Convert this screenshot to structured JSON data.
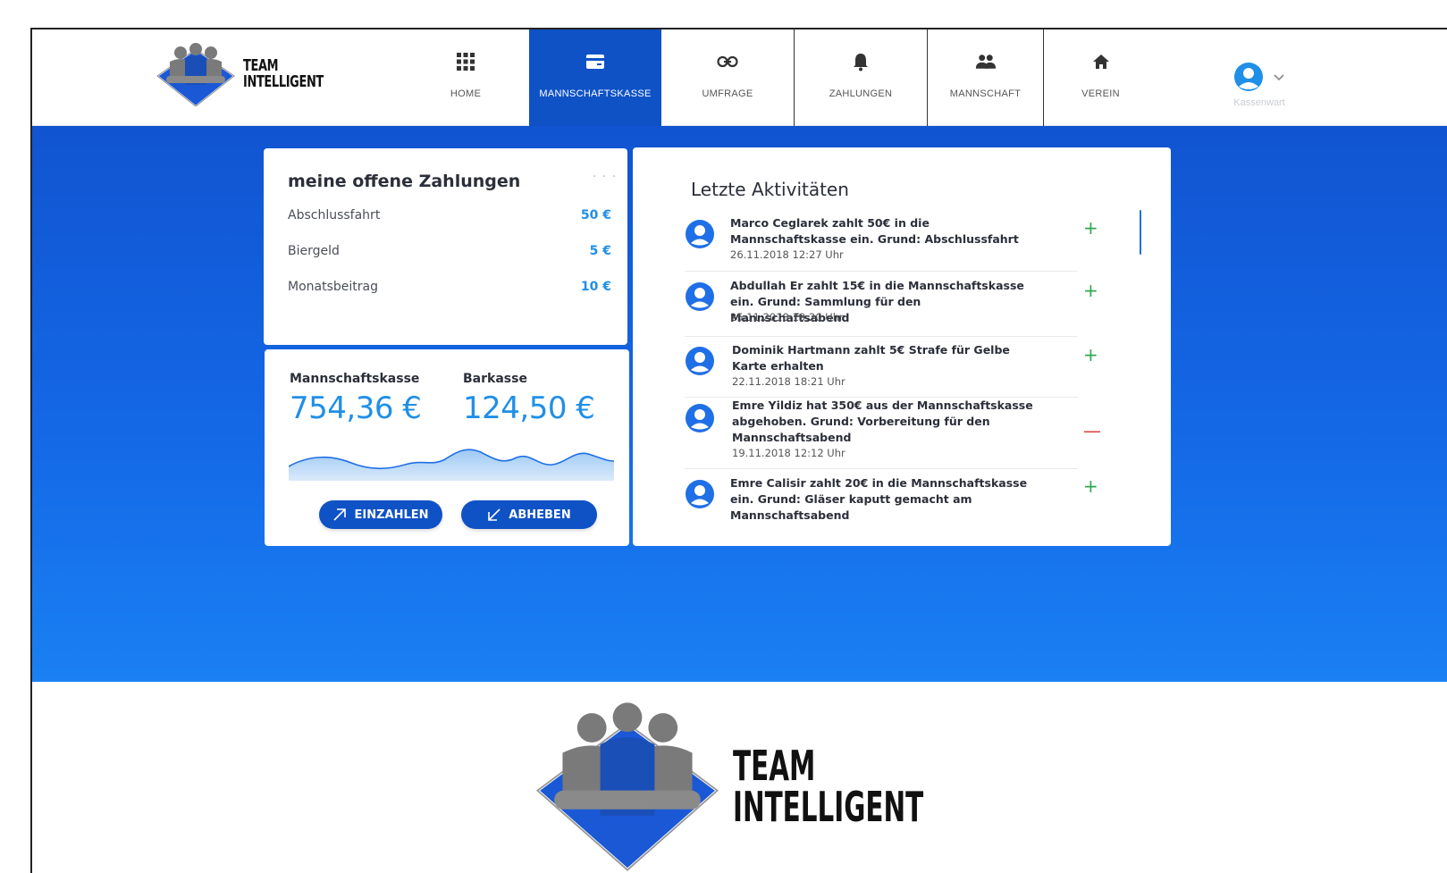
{
  "brand": {
    "line1": "TEAM",
    "line2": "INTELLIGENT"
  },
  "nav": {
    "items": [
      {
        "label": "HOME",
        "icon": "grid-icon"
      },
      {
        "label": "MANNSCHAFTSKASSE",
        "icon": "wallet-icon",
        "active": true
      },
      {
        "label": "UMFRAGE",
        "icon": "link-icon"
      },
      {
        "label": "ZAHLUNGEN",
        "icon": "bell-icon"
      },
      {
        "label": "MANNSCHAFT",
        "icon": "people-icon"
      },
      {
        "label": "VEREIN",
        "icon": "home-icon"
      }
    ]
  },
  "user": {
    "role": "Kassenwart",
    "icon": "user-circle-icon"
  },
  "open_payments": {
    "title": "meine offene Zahlungen",
    "menu": "· · ·",
    "items": [
      {
        "name": "Abschlussfahrt",
        "amount": "50 €"
      },
      {
        "name": "Biergeld",
        "amount": "5 €"
      },
      {
        "name": "Monatsbeitrag",
        "amount": "10 €"
      }
    ]
  },
  "cash": {
    "team_label": "Mannschaftskasse",
    "team_value": "754,36 €",
    "bar_label": "Barkasse",
    "bar_value": "124,50 €",
    "deposit_label": "EINZAHLEN",
    "withdraw_label": "ABHEBEN"
  },
  "activities": {
    "title": "Letzte Aktivitäten",
    "items": [
      {
        "text": "Marco Ceglarek zahlt 50€ in die Mannschaftskasse ein. Grund: Abschlussfahrt",
        "time": "26.11.2018 12:27 Uhr",
        "sign": "+"
      },
      {
        "text": "Abdullah Er zahlt 15€ in die Mannschaftskasse ein. Grund: Sammlung für den Mannschaftsabend",
        "time": "25.11.2018 19:20 Uhr",
        "sign": "+"
      },
      {
        "text": "Dominik Hartmann zahlt 5€ Strafe für Gelbe Karte erhalten",
        "time": "22.11.2018 18:21 Uhr",
        "sign": "+"
      },
      {
        "text": "Emre Yildiz hat 350€ aus der Mannschaftskasse abgehoben. Grund: Vorbereitung für den Mannschaftsabend",
        "time": "19.11.2018 12:12 Uhr",
        "sign": "—"
      },
      {
        "text": "Emre Calisir zahlt 20€ in die Mannschaftskasse ein. Grund: Gläser kaputt gemacht am Mannschaftsabend",
        "time": "",
        "sign": "+"
      }
    ]
  },
  "colors": {
    "primary": "#0f52c6",
    "accent": "#1f8fe8",
    "positive": "#2fa84f",
    "negative": "#e23b3b"
  }
}
